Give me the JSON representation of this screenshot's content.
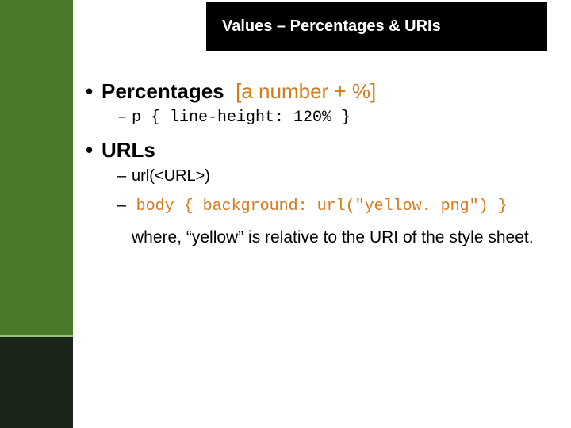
{
  "title": "Values – Percentages & URIs",
  "b1": {
    "label": "Percentages",
    "bracket": "[a number + %]",
    "sub_code": "p { line-height: 120% }"
  },
  "b2": {
    "label": "URLs",
    "sub1": "url(<URL>)",
    "sub2_code": "body { background: url(\"yellow. png\") }",
    "note": "where, “yellow” is relative to the URI of the style sheet."
  }
}
